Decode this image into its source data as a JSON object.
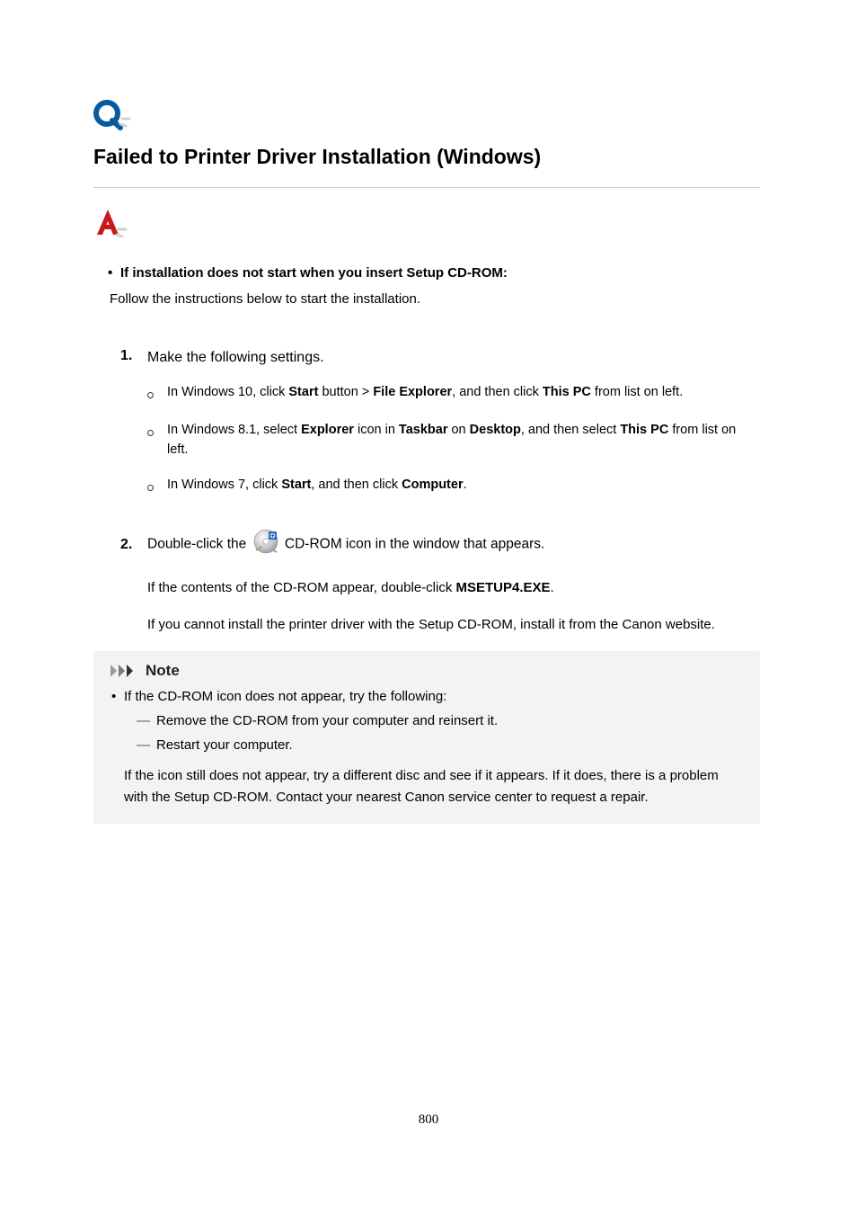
{
  "title": "Failed to Printer Driver Installation (Windows)",
  "section1": {
    "lead": "If installation does not start when you insert Setup CD-ROM:",
    "follow": "Follow the instructions below to start the installation."
  },
  "step1": {
    "num": "1.",
    "text": "Make the following settings.",
    "b1": {
      "pre": "In Windows 10, click ",
      "s1": "Start",
      "mid1": " button > ",
      "s2": "File Explorer",
      "mid2": ", and then click ",
      "s3": "This PC",
      "post": " from list on left."
    },
    "b2": {
      "pre": "In Windows 8.1, select ",
      "s1": "Explorer",
      "mid1": " icon in ",
      "s2": "Taskbar",
      "mid2": " on ",
      "s3": "Desktop",
      "mid3": ", and then select ",
      "s4": "This PC",
      "post": " from list on left."
    },
    "b3": {
      "pre": "In Windows 7, click ",
      "s1": "Start",
      "mid1": ", and then click ",
      "s2": "Computer",
      "post": "."
    }
  },
  "step2": {
    "num": "2.",
    "pre": "Double-click the ",
    "post": " CD-ROM icon in the window that appears.",
    "sub1_pre": "If the contents of the CD-ROM appear, double-click ",
    "sub1_bold": "MSETUP4.EXE",
    "sub1_post": ".",
    "sub2": "If you cannot install the printer driver with the Setup CD-ROM, install it from the Canon website."
  },
  "note": {
    "heading": "Note",
    "lead": "If the CD-ROM icon does not appear, try the following:",
    "d1": "Remove the CD-ROM from your computer and reinsert it.",
    "d2": "Restart your computer.",
    "para": "If the icon still does not appear, try a different disc and see if it appears. If it does, there is a problem with the Setup CD-ROM. Contact your nearest Canon service center to request a repair."
  },
  "page_number": "800"
}
